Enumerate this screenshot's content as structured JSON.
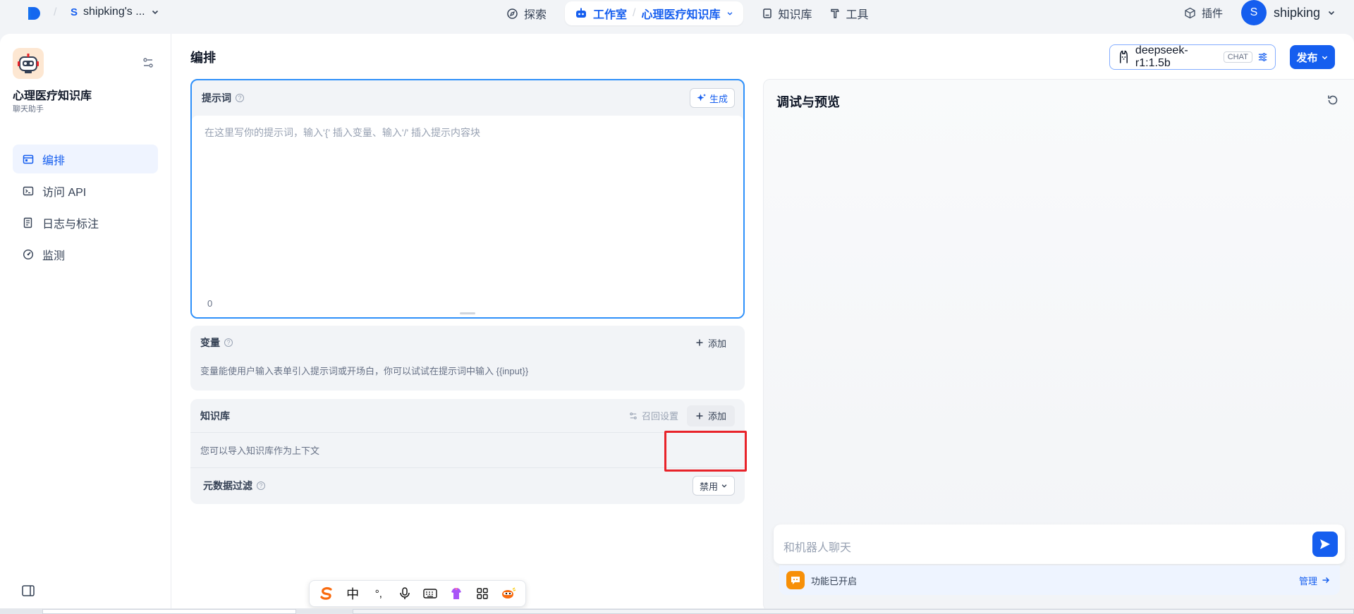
{
  "nav": {
    "workspace_initial": "S",
    "workspace_name": "shipking's ...",
    "explore": "探索",
    "studio": "工作室",
    "current_app": "心理医疗知识库",
    "knowledge": "知识库",
    "tools": "工具",
    "plugins": "插件",
    "user_initial": "S",
    "user_name": "shipking"
  },
  "sidebar": {
    "app_name": "心理医疗知识库",
    "app_type": "聊天助手",
    "items": [
      {
        "label": "编排",
        "icon": "layout-icon",
        "active": true
      },
      {
        "label": "访问 API",
        "icon": "terminal-icon",
        "active": false
      },
      {
        "label": "日志与标注",
        "icon": "file-list-icon",
        "active": false
      },
      {
        "label": "监测",
        "icon": "gauge-icon",
        "active": false
      }
    ]
  },
  "editor": {
    "title": "编排",
    "model_name": "deepseek-r1:1.5b",
    "model_badge": "CHAT",
    "publish_label": "发布",
    "prompt": {
      "title": "提示词",
      "generate_label": "生成",
      "placeholder": "在这里写你的提示词，输入'{' 插入变量、输入'/' 插入提示内容块",
      "char_count": "0"
    },
    "variables": {
      "title": "变量",
      "add_label": "添加",
      "description": "变量能使用户输入表单引入提示词或开场白，你可以试试在提示词中输入 {{input}}"
    },
    "knowledge": {
      "title": "知识库",
      "recall_label": "召回设置",
      "add_label": "添加",
      "description": "您可以导入知识库作为上下文"
    },
    "metadata_filter": {
      "title": "元数据过滤",
      "value": "禁用"
    }
  },
  "preview": {
    "title": "调试与预览",
    "chat_placeholder": "和机器人聊天",
    "feature_status": "功能已开启",
    "manage_label": "管理"
  },
  "ime": {
    "mode": "中",
    "punct": "°,"
  },
  "colors": {
    "accent": "#155eef",
    "highlight_box": "#e8232a",
    "feature_icon": "#f79009"
  }
}
